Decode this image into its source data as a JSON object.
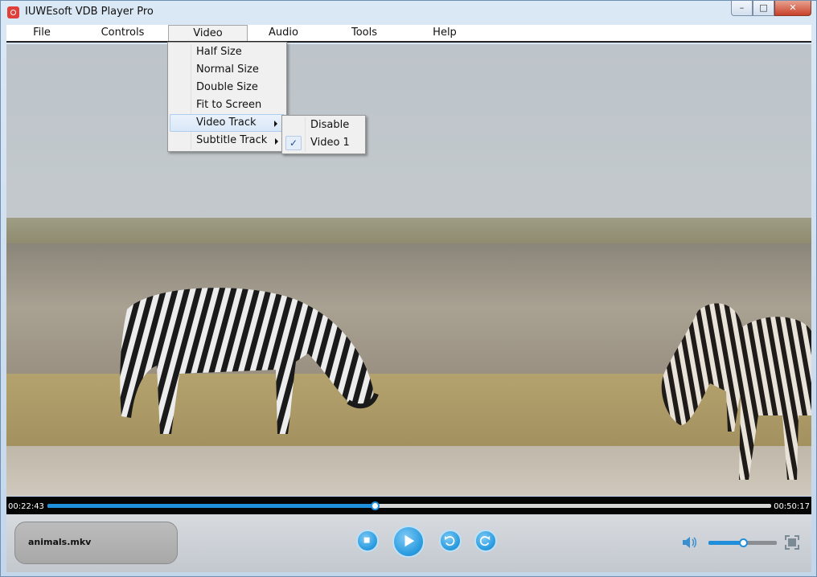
{
  "window": {
    "title": "IUWEsoft VDB Player Pro",
    "controls": {
      "minimize": "–",
      "maximize": "□",
      "close": "✕"
    }
  },
  "menubar": {
    "items": [
      {
        "label": "File"
      },
      {
        "label": "Controls"
      },
      {
        "label": "Video"
      },
      {
        "label": "Audio"
      },
      {
        "label": "Tools"
      },
      {
        "label": "Help"
      }
    ],
    "open_menu": "Video"
  },
  "video_menu": {
    "items": [
      {
        "label": "Half Size"
      },
      {
        "label": "Normal Size"
      },
      {
        "label": "Double Size"
      },
      {
        "label": "Fit to Screen"
      },
      {
        "label": "Video Track"
      },
      {
        "label": "Subtitle Track"
      }
    ],
    "highlighted": "Video Track"
  },
  "video_track_submenu": {
    "items": [
      {
        "label": "Disable",
        "checked": false
      },
      {
        "label": "Video 1",
        "checked": true
      }
    ],
    "check_glyph": "✓"
  },
  "playback": {
    "current_time": "00:22:43",
    "total_time": "00:50:17",
    "progress_fraction": 0.452,
    "volume_fraction": 0.5,
    "filename": "animals.mkv"
  },
  "colors": {
    "accent": "#1f8fdc",
    "menubar_bg": "#ffffff",
    "menu_bg": "#f0f0f0"
  },
  "icons": {
    "app": "app-icon",
    "stop": "stop-icon",
    "play": "play-icon",
    "rewind": "rewind-icon",
    "forward": "forward-icon",
    "volume": "speaker-icon",
    "fullscreen": "fullscreen-icon"
  }
}
